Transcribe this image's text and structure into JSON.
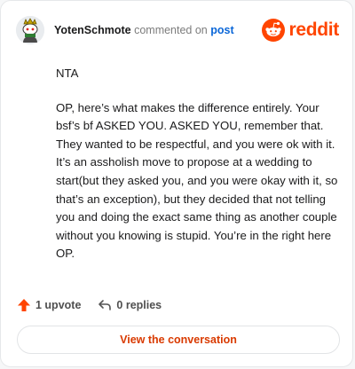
{
  "comment": {
    "username": "YotenSchmote",
    "action_text": "commented on",
    "post_link": "post",
    "paragraphs": [
      "NTA",
      "OP, here’s what makes the difference entirely. Your bsf’s bf ASKED YOU. ASKED YOU, remember that. They wanted to be respectful, and you were ok with it. It’s an assholish move to propose at a wedding to start(but they asked you, and you were okay with it, so that’s an exception), but they decided that not telling you and doing the exact same thing as another couple without you knowing is stupid. You’re in the right here OP."
    ],
    "upvotes_label": "1 upvote",
    "replies_label": "0 replies"
  },
  "brand": {
    "logo_text": "reddit",
    "color": "#ff4500"
  },
  "cta": {
    "label": "View the conversation"
  },
  "icons": {
    "avatar": "snoo-avatar",
    "upvote": "upvote-arrow-icon",
    "reply": "reply-arrow-icon",
    "logo": "reddit-alien-icon"
  }
}
